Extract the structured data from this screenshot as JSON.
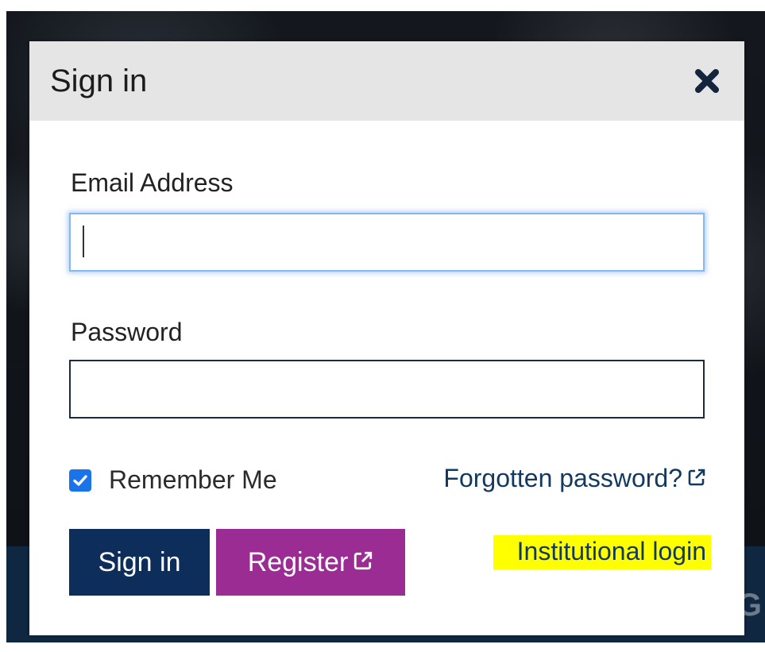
{
  "backdrop": {
    "fragment_text": "g G"
  },
  "modal": {
    "title": "Sign in",
    "close_icon": "close-x-icon"
  },
  "form": {
    "email_label": "Email Address",
    "email_value": "",
    "email_placeholder": "",
    "password_label": "Password",
    "password_value": "",
    "password_placeholder": "",
    "remember_label": "Remember Me",
    "remember_checked": true,
    "forgot_label": "Forgotten password?",
    "external_link_icon": "external-link-icon"
  },
  "actions": {
    "signin_label": "Sign in",
    "register_label": "Register",
    "institutional_label": "Institutional login"
  },
  "colors": {
    "header_bg": "#e5e5e5",
    "signin_button": "#0d2d5b",
    "register_button": "#9b2c94",
    "link_text": "#13395f",
    "highlight": "#ffff00",
    "checkbox": "#1a73e8"
  }
}
